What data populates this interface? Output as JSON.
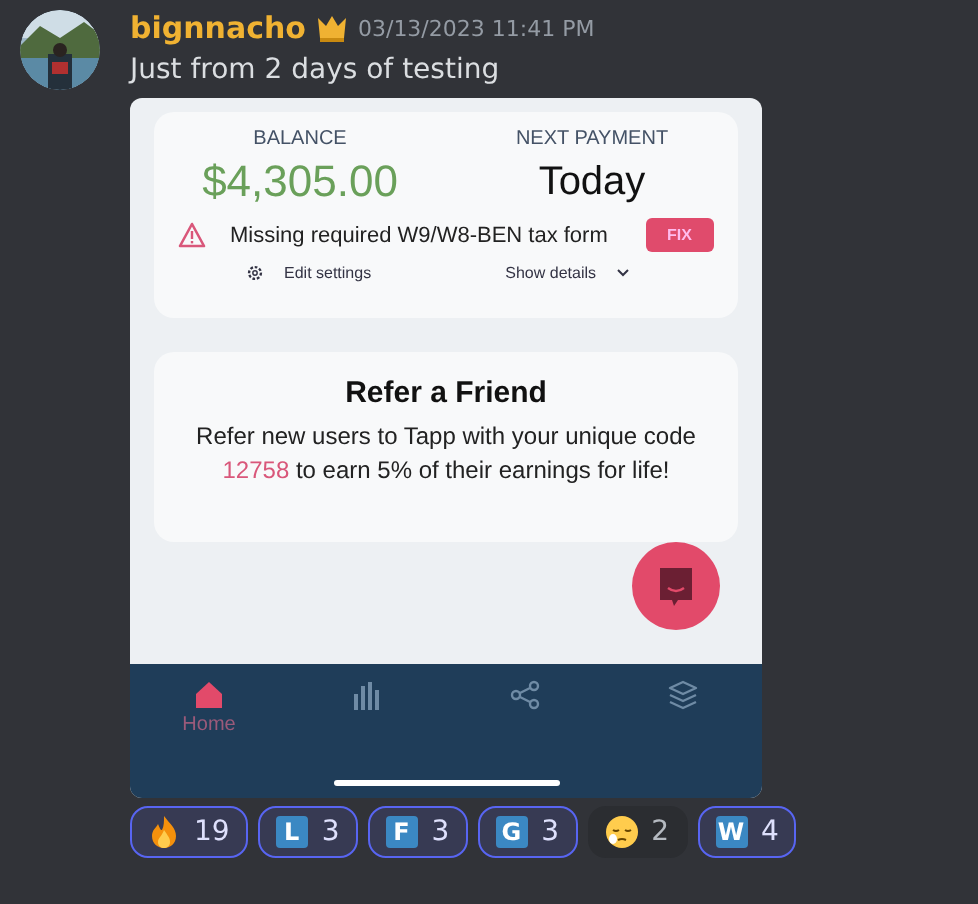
{
  "message": {
    "author": "bignnacho",
    "timestamp": "03/13/2023 11:41 PM",
    "text": "Just from 2 days of testing"
  },
  "app": {
    "balance": {
      "label": "BALANCE",
      "value": "$4,305.00"
    },
    "next_payment": {
      "label": "NEXT PAYMENT",
      "value": "Today"
    },
    "alert": {
      "text": "Missing required W9/W8-BEN tax form",
      "button": "FIX"
    },
    "links": [
      {
        "kind": "settings",
        "label": "Edit settings"
      },
      {
        "kind": "details",
        "label": "Show details"
      }
    ],
    "refer": {
      "title": "Refer a Friend",
      "text_before": "Refer new users to Tapp with your unique code",
      "code": "12758",
      "text_after": "to earn 5% of their earnings for life!"
    },
    "nav": [
      {
        "kind": "home",
        "label": "Home",
        "selected": true
      },
      {
        "kind": "chart",
        "selected": false
      },
      {
        "kind": "share",
        "selected": false
      },
      {
        "kind": "layers",
        "selected": false
      }
    ]
  },
  "reactions": [
    {
      "kind": "fire",
      "count": "19",
      "selected": true
    },
    {
      "kind": "letter",
      "letter": "L",
      "count": "3",
      "selected": true
    },
    {
      "kind": "letter",
      "letter": "F",
      "count": "3",
      "selected": true
    },
    {
      "kind": "letter",
      "letter": "G",
      "count": "3",
      "selected": true
    },
    {
      "kind": "sleepy",
      "count": "2",
      "selected": false
    },
    {
      "kind": "letter",
      "letter": "W",
      "count": "4",
      "selected": true
    }
  ]
}
